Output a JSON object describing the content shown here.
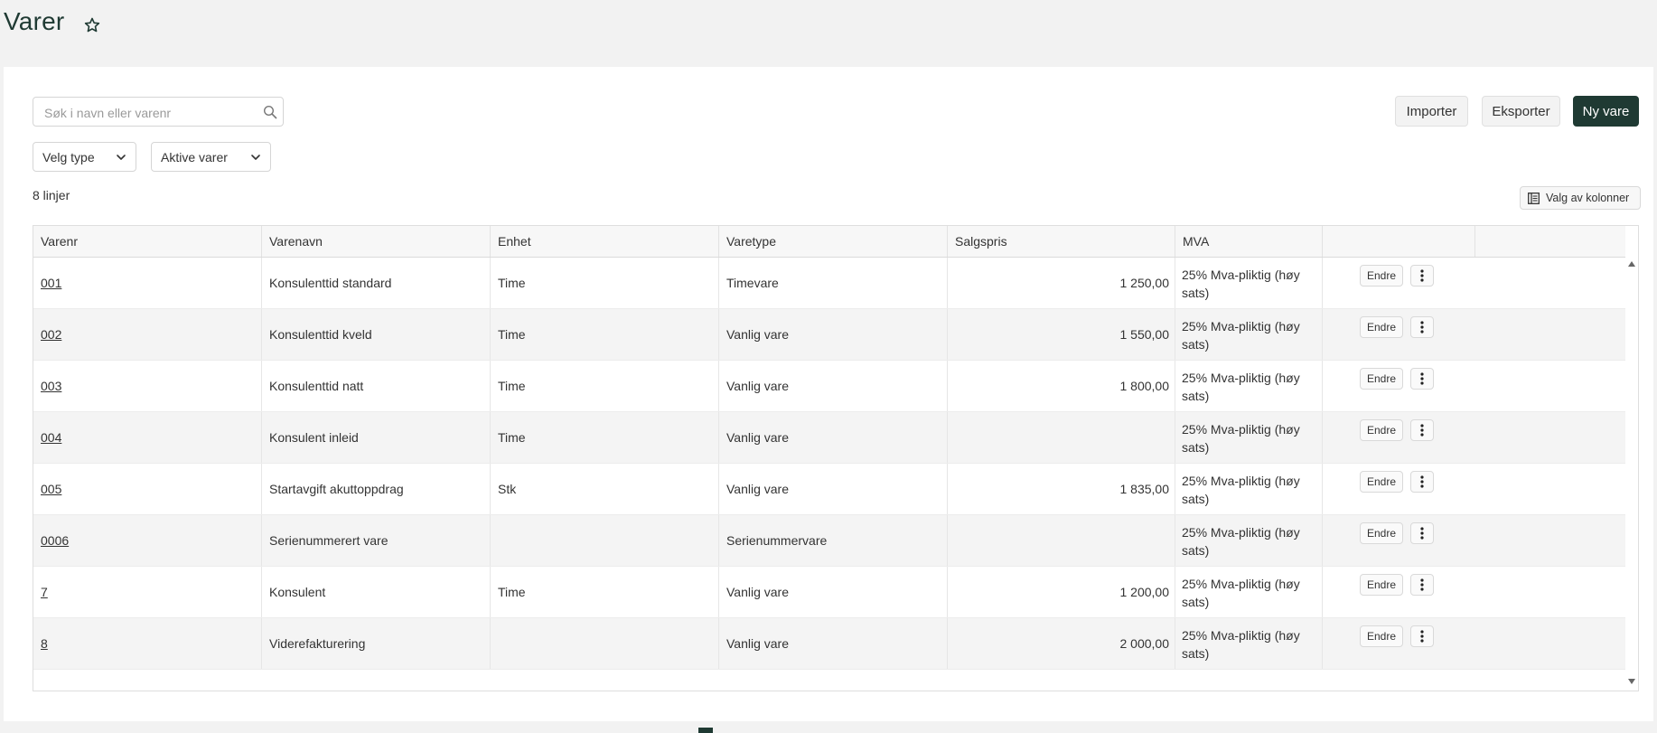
{
  "page": {
    "title": "Varer"
  },
  "toolbar": {
    "search_placeholder": "Søk i navn eller varenr",
    "import_label": "Importer",
    "export_label": "Eksporter",
    "new_item_label": "Ny vare"
  },
  "filters": {
    "type": {
      "selected": "Velg type"
    },
    "status": {
      "selected": "Aktive varer"
    }
  },
  "line_count": "8 linjer",
  "column_chooser_label": "Valg av kolonner",
  "table": {
    "columns": [
      "Varenr",
      "Varenavn",
      "Enhet",
      "Varetype",
      "Salgspris",
      "MVA",
      ""
    ],
    "edit_label": "Endre",
    "rows": [
      {
        "varenr": "001",
        "varenavn": "Konsulenttid standard",
        "enhet": "Time",
        "varetype": "Timevare",
        "salgspris": "1 250,00",
        "mva": "25% Mva-pliktig (høy sats)"
      },
      {
        "varenr": "002",
        "varenavn": "Konsulenttid kveld",
        "enhet": "Time",
        "varetype": "Vanlig vare",
        "salgspris": "1 550,00",
        "mva": "25% Mva-pliktig (høy sats)"
      },
      {
        "varenr": "003",
        "varenavn": "Konsulenttid natt",
        "enhet": "Time",
        "varetype": "Vanlig vare",
        "salgspris": "1 800,00",
        "mva": "25% Mva-pliktig (høy sats)"
      },
      {
        "varenr": "004",
        "varenavn": "Konsulent inleid",
        "enhet": "Time",
        "varetype": "Vanlig vare",
        "salgspris": "",
        "mva": "25% Mva-pliktig (høy sats)"
      },
      {
        "varenr": "005",
        "varenavn": "Startavgift akuttoppdrag",
        "enhet": "Stk",
        "varetype": "Vanlig vare",
        "salgspris": "1 835,00",
        "mva": "25% Mva-pliktig (høy sats)"
      },
      {
        "varenr": "0006",
        "varenavn": "Serienummerert vare",
        "enhet": "",
        "varetype": "Serienummervare",
        "salgspris": "",
        "mva": "25% Mva-pliktig (høy sats)"
      },
      {
        "varenr": "7",
        "varenavn": "Konsulent",
        "enhet": "Time",
        "varetype": "Vanlig vare",
        "salgspris": "1 200,00",
        "mva": "25% Mva-pliktig (høy sats)"
      },
      {
        "varenr": "8",
        "varenavn": "Viderefakturering",
        "enhet": "",
        "varetype": "Vanlig vare",
        "salgspris": "2 000,00",
        "mva": "25% Mva-pliktig (høy sats)"
      }
    ]
  },
  "icons": {
    "favorite": "star-icon",
    "search": "search-icon",
    "dropdown": "chevron-down-icon",
    "columns": "columns-icon",
    "row_menu": "kebab-menu-icon"
  },
  "colors": {
    "brand": "#1f3a33",
    "background": "#f2f2f2"
  }
}
